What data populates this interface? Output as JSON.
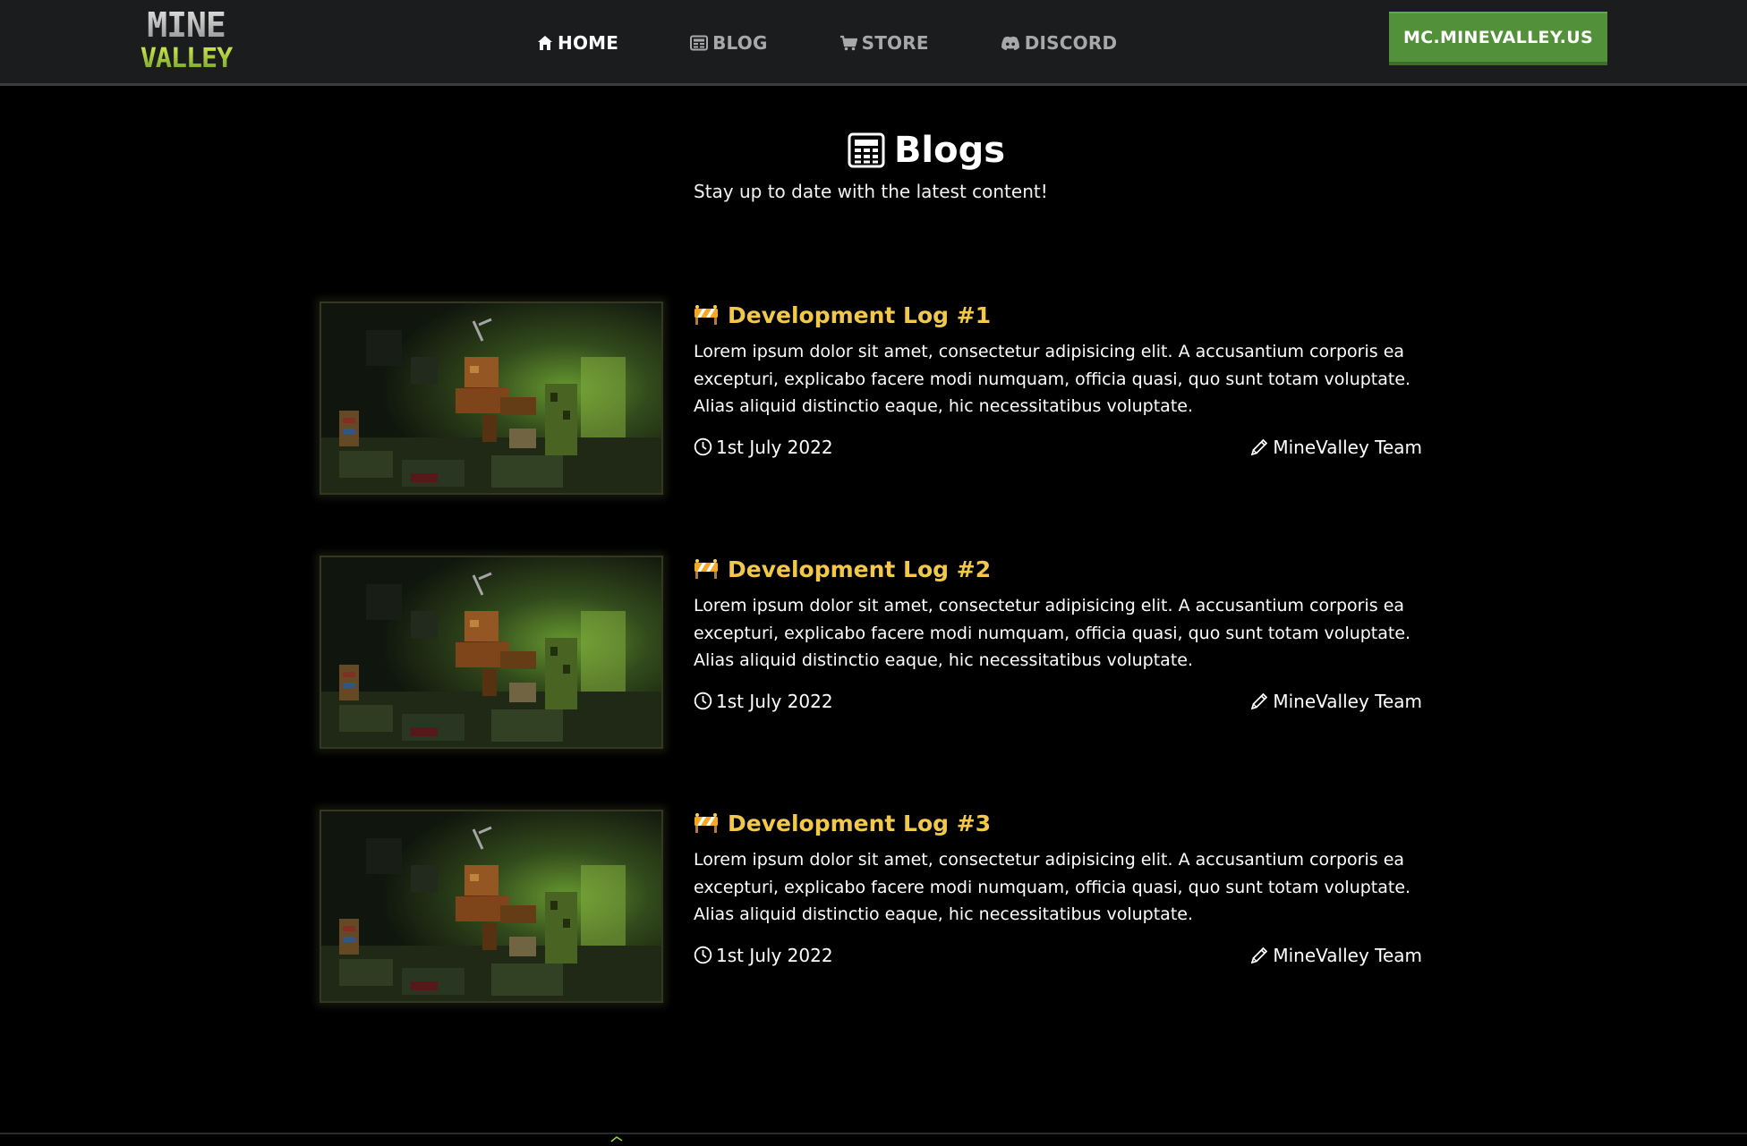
{
  "brand": {
    "logo_line1": "MINE",
    "logo_line2": "VALLEY",
    "colors": {
      "accent_green": "#52913a",
      "title_gold": "#f2c84b",
      "nav_bg": "#1b1c1e"
    }
  },
  "nav": {
    "items": [
      {
        "label": "HOME",
        "icon": "home-icon",
        "active": true
      },
      {
        "label": "BLOG",
        "icon": "newspaper-icon",
        "active": false
      },
      {
        "label": "STORE",
        "icon": "cart-icon",
        "active": false
      },
      {
        "label": "DISCORD",
        "icon": "discord-icon",
        "active": false
      }
    ],
    "server_ip": "MC.MINEVALLEY.US"
  },
  "header": {
    "title": "Blogs",
    "title_icon": "newspaper-icon",
    "subtitle": "Stay up to date with the latest content!"
  },
  "posts": [
    {
      "title": "Development Log #1",
      "title_icon": "construction-barrier-icon",
      "excerpt": "Lorem ipsum dolor sit amet, consectetur adipisicing elit. A accusantium corporis ea excepturi, explicabo facere modi numquam, officia quasi, quo sunt totam voluptate. Alias aliquid distinctio eaque, hic necessitatibus voluptate.",
      "date": "1st July 2022",
      "author": "MineValley Team"
    },
    {
      "title": "Development Log #2",
      "title_icon": "construction-barrier-icon",
      "excerpt": "Lorem ipsum dolor sit amet, consectetur adipisicing elit. A accusantium corporis ea excepturi, explicabo facere modi numquam, officia quasi, quo sunt totam voluptate. Alias aliquid distinctio eaque, hic necessitatibus voluptate.",
      "date": "1st July 2022",
      "author": "MineValley Team"
    },
    {
      "title": "Development Log #3",
      "title_icon": "construction-barrier-icon",
      "excerpt": "Lorem ipsum dolor sit amet, consectetur adipisicing elit. A accusantium corporis ea excepturi, explicabo facere modi numquam, officia quasi, quo sunt totam voluptate. Alias aliquid distinctio eaque, hic necessitatibus voluptate.",
      "date": "1st July 2022",
      "author": "MineValley Team"
    }
  ]
}
